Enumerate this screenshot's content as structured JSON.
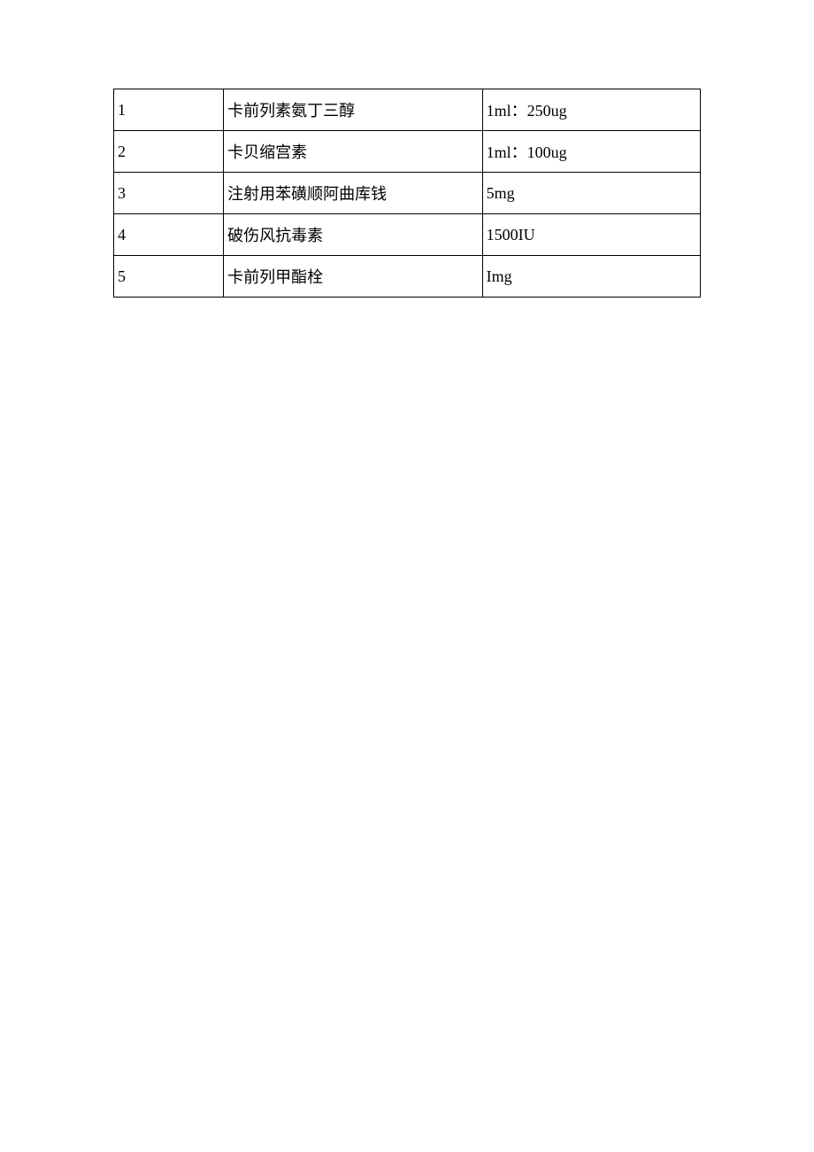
{
  "table": {
    "rows": [
      {
        "no": "1",
        "name": "卡前列素氨丁三醇",
        "spec": "1ml：250ug"
      },
      {
        "no": "2",
        "name": "卡贝缩宫素",
        "spec": "1ml：100ug"
      },
      {
        "no": "3",
        "name": "注射用苯磺顺阿曲库钱",
        "spec": "5mg"
      },
      {
        "no": "4",
        "name": "破伤风抗毒素",
        "spec": "1500IU"
      },
      {
        "no": "5",
        "name": "卡前列甲酯栓",
        "spec": "Img"
      }
    ]
  }
}
